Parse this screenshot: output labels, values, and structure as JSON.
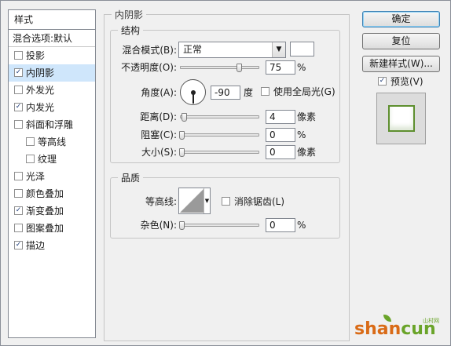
{
  "dialog": {
    "style_list": {
      "header": "样式",
      "blend_options": "混合选项:默认",
      "items": [
        {
          "label": "投影",
          "checked": false,
          "selected": false,
          "sub": false
        },
        {
          "label": "内阴影",
          "checked": true,
          "selected": true,
          "sub": false
        },
        {
          "label": "外发光",
          "checked": false,
          "selected": false,
          "sub": false
        },
        {
          "label": "内发光",
          "checked": true,
          "selected": false,
          "sub": false
        },
        {
          "label": "斜面和浮雕",
          "checked": false,
          "selected": false,
          "sub": false
        },
        {
          "label": "等高线",
          "checked": false,
          "selected": false,
          "sub": true
        },
        {
          "label": "纹理",
          "checked": false,
          "selected": false,
          "sub": true
        },
        {
          "label": "光泽",
          "checked": false,
          "selected": false,
          "sub": false
        },
        {
          "label": "颜色叠加",
          "checked": false,
          "selected": false,
          "sub": false
        },
        {
          "label": "渐变叠加",
          "checked": true,
          "selected": false,
          "sub": false
        },
        {
          "label": "图案叠加",
          "checked": false,
          "selected": false,
          "sub": false
        },
        {
          "label": "描边",
          "checked": true,
          "selected": false,
          "sub": false
        }
      ]
    },
    "buttons": {
      "ok": "确定",
      "reset": "复位",
      "new_style": "新建样式(W)..."
    },
    "preview": {
      "label": "预览(V)",
      "checked": true
    },
    "panel": {
      "title": "内阴影",
      "structure": {
        "title": "结构",
        "blend_mode_label": "混合模式(B):",
        "blend_mode_value": "正常",
        "opacity_label": "不透明度(O):",
        "opacity_value": "75",
        "percent": "%",
        "angle_label": "角度(A):",
        "angle_value": "-90",
        "angle_unit": "度",
        "global_light_label": "使用全局光(G)",
        "global_light_checked": false,
        "distance_label": "距离(D):",
        "distance_value": "4",
        "px_unit": "像素",
        "choke_label": "阻塞(C):",
        "choke_value": "0",
        "size_label": "大小(S):",
        "size_value": "0"
      },
      "quality": {
        "title": "品质",
        "contour_label": "等高线:",
        "antialias_label": "消除锯齿(L)",
        "antialias_checked": false,
        "noise_label": "杂色(N):",
        "noise_value": "0"
      }
    },
    "watermark": {
      "brand": "shancun",
      "sub": "山村网"
    }
  }
}
